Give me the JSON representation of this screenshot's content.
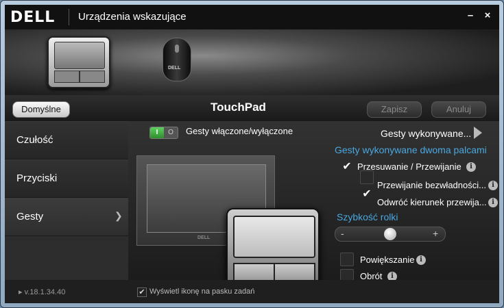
{
  "window": {
    "title": "Urządzenia wskazujące",
    "logo": "DELL",
    "minimize": "–",
    "close": "×"
  },
  "devices": [
    {
      "name": "touchpad",
      "icon": "touchpad-icon"
    },
    {
      "name": "mouse",
      "icon": "mouse-icon",
      "brand": "DELL"
    }
  ],
  "toolbar": {
    "default_label": "Domyślne",
    "section_title": "TouchPad",
    "save_label": "Zapisz",
    "cancel_label": "Anuluj"
  },
  "sidebar": {
    "items": [
      {
        "label": "Czułość"
      },
      {
        "label": "Przyciski"
      },
      {
        "label": "Gesty"
      }
    ]
  },
  "main": {
    "toggle": {
      "on": "I",
      "off": "O",
      "label": "Gesty włączone/wyłączone"
    },
    "gestures_link": "Gesty wykonywane...",
    "preview_brand": "DELL",
    "two_finger_title": "Gesty wykonywane dwoma palcami",
    "options": [
      {
        "label": "Przesuwanie / Przewijanie",
        "checked": true
      },
      {
        "label": "Przewijanie bezwładności...",
        "checked": false
      },
      {
        "label": "Odwróć kierunek przewija...",
        "checked": true
      }
    ],
    "speed_title": "Szybkość rolki",
    "slider": {
      "minus": "-",
      "plus": "+",
      "value": 0.5
    },
    "extra_options": [
      {
        "label": "Powiększanie",
        "checked": false
      },
      {
        "label": "Obrót",
        "checked": false
      }
    ],
    "info_glyph": "i"
  },
  "footer": {
    "version": "v.18.1.34.40",
    "tray_label": "Wyświetl ikonę na pasku zadań",
    "tray_checked": true,
    "check_glyph": "✔"
  },
  "colors": {
    "accent": "#4aa8e0",
    "toggle_on": "#3fae3f"
  }
}
